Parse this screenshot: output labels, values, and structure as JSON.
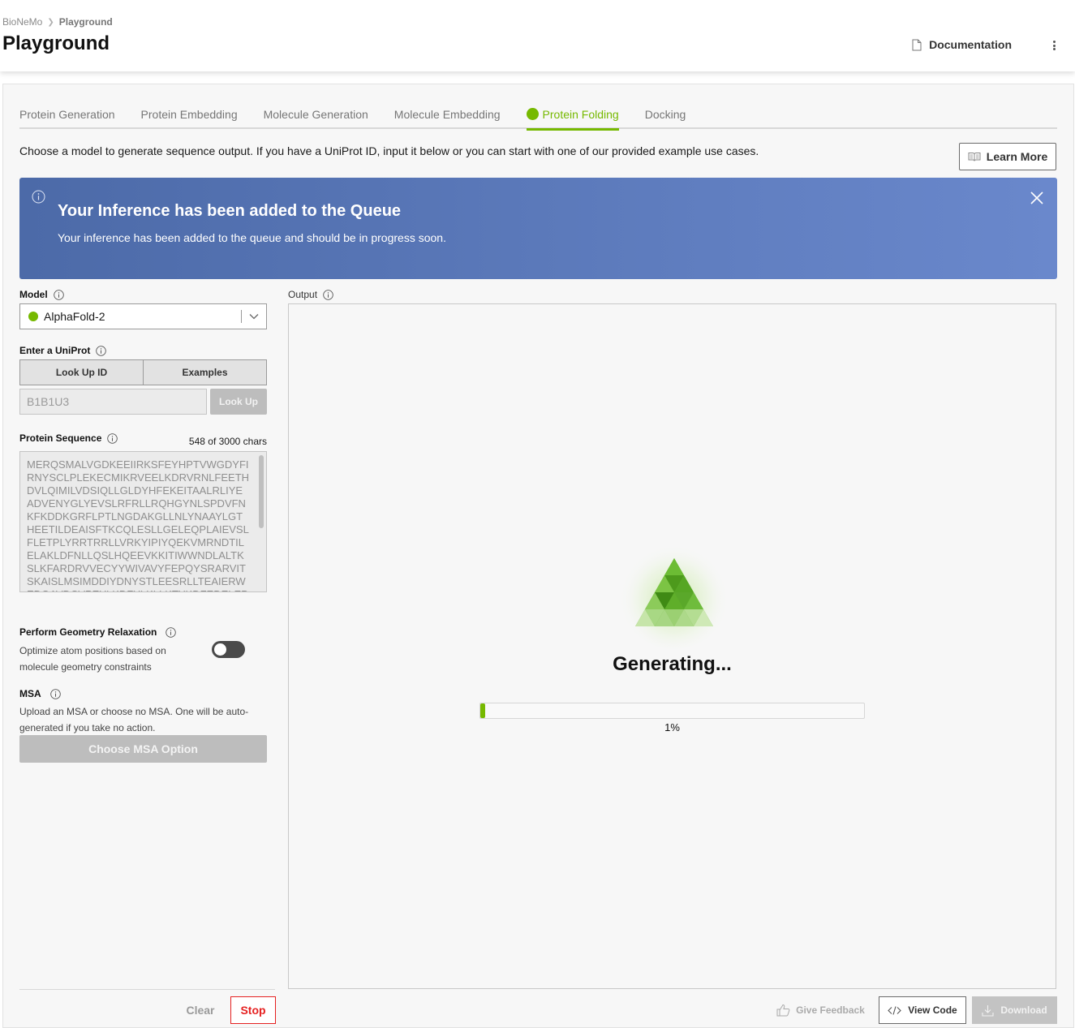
{
  "breadcrumb": {
    "root": "BioNeMo",
    "current": "Playground"
  },
  "header": {
    "title": "Playground",
    "documentation_label": "Documentation"
  },
  "tabs": [
    {
      "label": "Protein Generation",
      "active": false
    },
    {
      "label": "Protein Embedding",
      "active": false
    },
    {
      "label": "Molecule Generation",
      "active": false
    },
    {
      "label": "Molecule Embedding",
      "active": false
    },
    {
      "label": "Protein Folding",
      "active": true
    },
    {
      "label": "Docking",
      "active": false
    }
  ],
  "intro": "Choose a model to generate sequence output. If you have a UniProt ID, input it below or you can start with one of our provided example use cases.",
  "learn_more_label": "Learn More",
  "banner": {
    "title": "Your Inference has been added to the Queue",
    "subtitle": "Your inference has been added to the queue and should be in progress soon."
  },
  "model": {
    "label": "Model",
    "selected": "AlphaFold-2"
  },
  "uniprot": {
    "label": "Enter a UniProt",
    "lookup_id_label": "Look Up ID",
    "examples_label": "Examples",
    "value": "B1B1U3",
    "lookup_button": "Look Up"
  },
  "sequence": {
    "label": "Protein Sequence",
    "count": "548 of 3000 chars",
    "text": "MERQSMALVGDKEEIIRKSFEYHPTVWGDYFI\nRNYSCLPLEKECMIKRVEELKDRVRNLFEETH\nDVLQIMILVDSIQLLGLDYHFEKEITAALRLIYE\nADVENYGLYEVSLRFRLLRQHGYNLSPDVFN\nKFKDDKGRFLPTLNGDAKGLLNLYNAAYLGT\nHEETILDEAISFTKCQLESLLGELEQPLAIEVSL\nFLETPLYRRTRRLLVRKYIPIYQEKVMRNDTIL\nELAKLDFNLLQSLHQEEVKKITIWWNDLALTK\nSLKFARDRVVECYYWIVAVYFEPQYSRARVIT\nSKAISLMSIMDDIYDNYSTLEESRLLTEAIERW\nEDQAVDCVPEYLKDFYLKLLKTYKDFEDELEP"
  },
  "geometry": {
    "label": "Perform Geometry Relaxation",
    "description": "Optimize atom positions based on molecule geometry constraints",
    "enabled": false
  },
  "msa": {
    "label": "MSA",
    "description": "Upload an MSA or choose no MSA. One will be auto-generated if you take no action.",
    "button": "Choose MSA Option"
  },
  "output": {
    "label": "Output",
    "status": "Generating...",
    "progress_fraction": 0.01,
    "progress_label": "1%"
  },
  "actions": {
    "clear": "Clear",
    "stop": "Stop",
    "feedback": "Give Feedback",
    "view_code": "View Code",
    "download": "Download"
  },
  "colors": {
    "accent": "#76b900",
    "danger": "#e52020",
    "banner_start": "#4c6aa8",
    "banner_end": "#6a88cc"
  }
}
